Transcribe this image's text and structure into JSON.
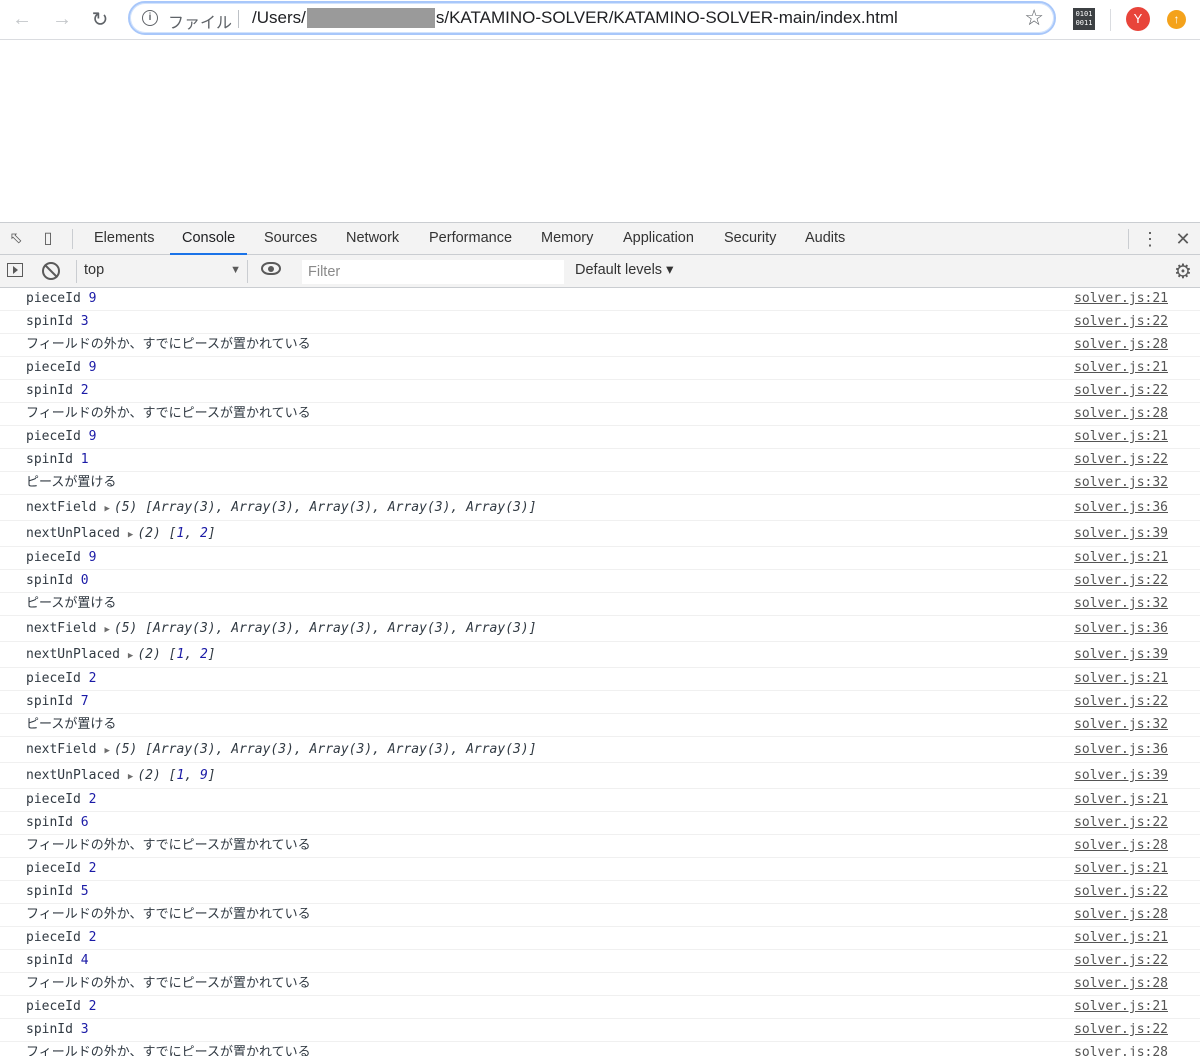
{
  "browser": {
    "scheme_label": "ファイル",
    "url_prefix": "/Users/",
    "url_suffix": "s/KATAMINO-SOLVER/KATAMINO-SOLVER-main/index.html",
    "avatar_initial": "Y",
    "binary_icon_text": "0101 0011"
  },
  "devtools": {
    "tabs": [
      "Elements",
      "Console",
      "Sources",
      "Network",
      "Performance",
      "Memory",
      "Application",
      "Security",
      "Audits"
    ],
    "active_tab": "Console"
  },
  "console_toolbar": {
    "context": "top",
    "filter_placeholder": "Filter",
    "levels_label": "Default levels ▾"
  },
  "messages": [
    {
      "label": "pieceId",
      "value": "9",
      "source": "solver.js:21"
    },
    {
      "label": "spinId",
      "value": "3",
      "source": "solver.js:22"
    },
    {
      "text": "フィールドの外か、すでにピースが置かれている",
      "source": "solver.js:28"
    },
    {
      "label": "pieceId",
      "value": "9",
      "source": "solver.js:21"
    },
    {
      "label": "spinId",
      "value": "2",
      "source": "solver.js:22"
    },
    {
      "text": "フィールドの外か、すでにピースが置かれている",
      "source": "solver.js:28"
    },
    {
      "label": "pieceId",
      "value": "9",
      "source": "solver.js:21"
    },
    {
      "label": "spinId",
      "value": "1",
      "source": "solver.js:22"
    },
    {
      "text": "ピースが置ける",
      "source": "solver.js:32"
    },
    {
      "label": "nextField",
      "object": "(5) [Array(3), Array(3), Array(3), Array(3), Array(3)]",
      "source": "solver.js:36"
    },
    {
      "label": "nextUnPlaced",
      "object_prefix": "(2) [",
      "object_items": [
        "1",
        "2"
      ],
      "source": "solver.js:39"
    },
    {
      "label": "pieceId",
      "value": "9",
      "source": "solver.js:21"
    },
    {
      "label": "spinId",
      "value": "0",
      "source": "solver.js:22"
    },
    {
      "text": "ピースが置ける",
      "source": "solver.js:32"
    },
    {
      "label": "nextField",
      "object": "(5) [Array(3), Array(3), Array(3), Array(3), Array(3)]",
      "source": "solver.js:36"
    },
    {
      "label": "nextUnPlaced",
      "object_prefix": "(2) [",
      "object_items": [
        "1",
        "2"
      ],
      "source": "solver.js:39"
    },
    {
      "label": "pieceId",
      "value": "2",
      "source": "solver.js:21"
    },
    {
      "label": "spinId",
      "value": "7",
      "source": "solver.js:22"
    },
    {
      "text": "ピースが置ける",
      "source": "solver.js:32"
    },
    {
      "label": "nextField",
      "object": "(5) [Array(3), Array(3), Array(3), Array(3), Array(3)]",
      "source": "solver.js:36"
    },
    {
      "label": "nextUnPlaced",
      "object_prefix": "(2) [",
      "object_items": [
        "1",
        "9"
      ],
      "source": "solver.js:39"
    },
    {
      "label": "pieceId",
      "value": "2",
      "source": "solver.js:21"
    },
    {
      "label": "spinId",
      "value": "6",
      "source": "solver.js:22"
    },
    {
      "text": "フィールドの外か、すでにピースが置かれている",
      "source": "solver.js:28"
    },
    {
      "label": "pieceId",
      "value": "2",
      "source": "solver.js:21"
    },
    {
      "label": "spinId",
      "value": "5",
      "source": "solver.js:22"
    },
    {
      "text": "フィールドの外か、すでにピースが置かれている",
      "source": "solver.js:28"
    },
    {
      "label": "pieceId",
      "value": "2",
      "source": "solver.js:21"
    },
    {
      "label": "spinId",
      "value": "4",
      "source": "solver.js:22"
    },
    {
      "text": "フィールドの外か、すでにピースが置かれている",
      "source": "solver.js:28"
    },
    {
      "label": "pieceId",
      "value": "2",
      "source": "solver.js:21"
    },
    {
      "label": "spinId",
      "value": "3",
      "source": "solver.js:22"
    },
    {
      "text": "フィールドの外か、すでにピースが置かれている",
      "source": "solver.js:28"
    }
  ]
}
